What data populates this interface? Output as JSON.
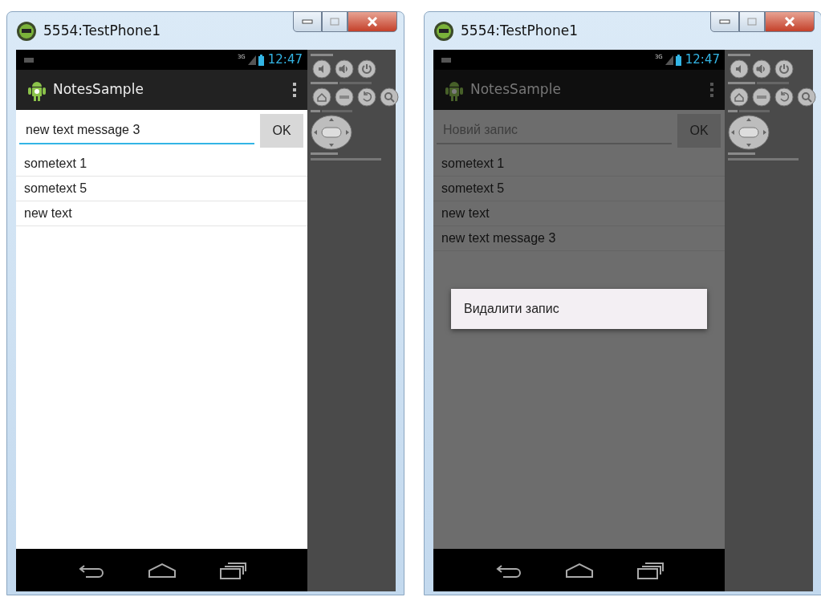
{
  "windows": [
    {
      "title": "5554:TestPhone1",
      "status_bar": {
        "network": "3G",
        "time": "12:47"
      },
      "app_title": "NotesSample",
      "input": {
        "value": "new text message 3",
        "focused": true
      },
      "ok_button": "OK",
      "notes": [
        "sometext 1",
        "sometext 5",
        "new text"
      ],
      "dimmed": false
    },
    {
      "title": "5554:TestPhone1",
      "status_bar": {
        "network": "3G",
        "time": "12:47"
      },
      "app_title": "NotesSample",
      "input": {
        "placeholder": "Новий запис",
        "focused": false
      },
      "ok_button": "OK",
      "notes": [
        "sometext 1",
        "sometext 5",
        "new text",
        "new text message 3"
      ],
      "dimmed": true,
      "dialog": {
        "items": [
          "Видалити запис"
        ]
      }
    }
  ]
}
